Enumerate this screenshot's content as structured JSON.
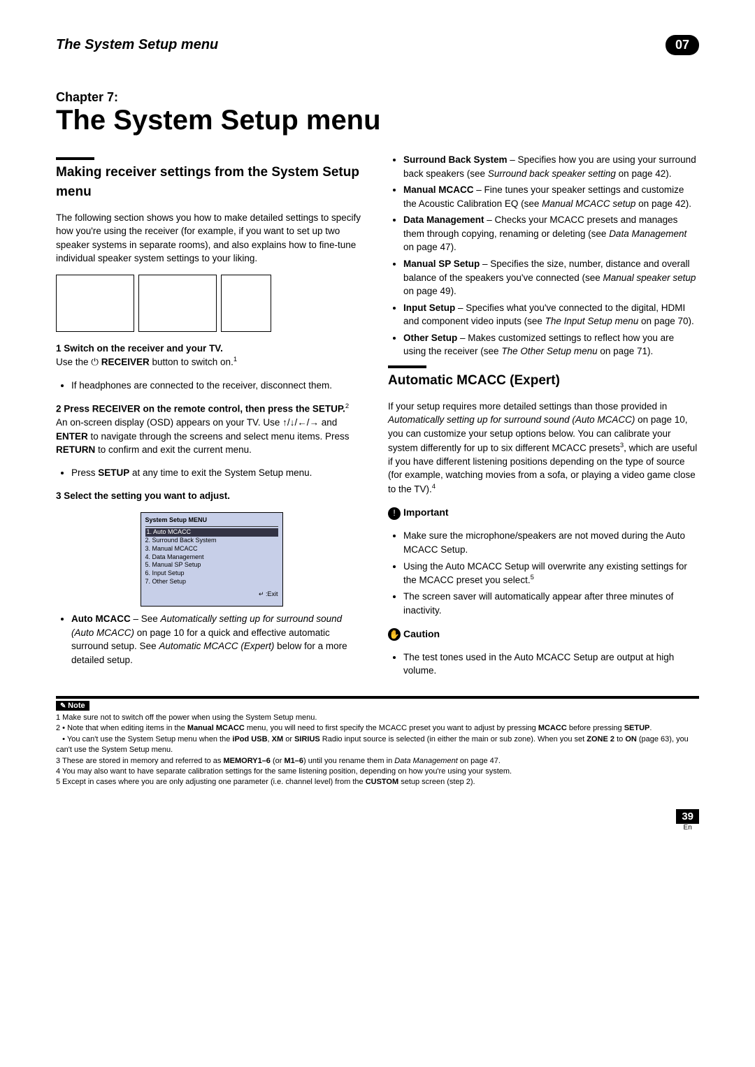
{
  "header": {
    "title": "The System Setup menu",
    "badge": "07"
  },
  "chapter": {
    "label": "Chapter 7:",
    "title": "The System Setup menu"
  },
  "col1": {
    "section_title": "Making receiver settings from the System Setup menu",
    "intro": "The following section shows you how to make detailed settings to specify how you're using the receiver (for example, if you want to set up two speaker systems in separate rooms), and also explains how to fine-tune individual speaker system settings to your liking.",
    "step1_label": "1   Switch on the receiver and your TV.",
    "step1_text_a": "Use the ",
    "step1_receiver": " RECEIVER",
    "step1_text_b": " button to switch on.",
    "step1_sup": "1",
    "step1_bullet": "If headphones are connected to the receiver, disconnect them.",
    "step2_label": "2   Press RECEIVER on the remote control, then press the SETUP.",
    "step2_sup": "2",
    "step2_text": "An on-screen display (OSD) appears on your TV. Use ↑/↓/←/→ and ENTER to navigate through the screens and select menu items. Press RETURN to confirm and exit the current menu.",
    "step2_bullet_a": "Press ",
    "step2_bullet_setup": "SETUP",
    "step2_bullet_b": " at any time to exit the System Setup menu.",
    "step3_label": "3   Select the setting you want to adjust.",
    "osd": {
      "title": "System Setup MENU",
      "items": [
        "1. Auto MCACC",
        "2. Surround Back System",
        "3. Manual MCACC",
        "4. Data Management",
        "5. Manual SP Setup",
        "6. Input Setup",
        "7. Other Setup"
      ],
      "exit": "↵ :Exit"
    },
    "auto_mcacc_a": "Auto MCACC",
    "auto_mcacc_b": " – See ",
    "auto_mcacc_c": "Automatically setting up for surround sound (Auto MCACC)",
    "auto_mcacc_d": " on page 10 for a quick and effective automatic surround setup. See ",
    "auto_mcacc_e": "Automatic MCACC (Expert)",
    "auto_mcacc_f": " below for a more detailed setup."
  },
  "col2": {
    "items": [
      {
        "name": "Surround Back System",
        "desc": " – Specifies how you are using your surround back speakers (see ",
        "ref": "Surround back speaker setting",
        "tail": " on page 42)."
      },
      {
        "name": "Manual MCACC",
        "desc": " – Fine tunes your speaker settings and customize the Acoustic Calibration EQ (see ",
        "ref": "Manual MCACC setup",
        "tail": " on page 42)."
      },
      {
        "name": "Data Management",
        "desc": " – Checks your MCACC presets and manages them through copying, renaming or deleting (see ",
        "ref": "Data Management",
        "tail": " on page 47)."
      },
      {
        "name": "Manual SP Setup",
        "desc": " – Specifies the size, number, distance and overall balance of the speakers you've connected (see ",
        "ref": "Manual speaker setup",
        "tail": " on page 49)."
      },
      {
        "name": "Input Setup",
        "desc": " – Specifies what you've connected to the digital, HDMI and component video inputs (see ",
        "ref": "The Input Setup menu",
        "tail": " on page 70)."
      },
      {
        "name": "Other Setup",
        "desc": " – Makes customized settings to reflect how you are using the receiver (see ",
        "ref": "The Other Setup menu",
        "tail": " on page 71)."
      }
    ],
    "expert_title": "Automatic MCACC (Expert)",
    "expert_body_a": "If your setup requires more detailed settings than those provided in ",
    "expert_body_b": "Automatically setting up for surround sound (Auto MCACC)",
    "expert_body_c": " on page 10, you can customize your setup options below. You can calibrate your system differently for up to six different MCACC presets",
    "expert_sup3": "3",
    "expert_body_d": ", which are useful if you have different listening positions depending on the type of source (for example, watching movies from a sofa, or playing a video game close to the TV).",
    "expert_sup4": "4",
    "important_label": "Important",
    "important_items": [
      "Make sure the microphone/speakers are not moved during the Auto MCACC Setup.",
      "Using the Auto MCACC Setup will overwrite any existing settings for the MCACC preset you select.",
      "The screen saver will automatically appear after three minutes of inactivity."
    ],
    "important_sup5": "5",
    "caution_label": "Caution",
    "caution_item": "The test tones used in the Auto MCACC Setup are output at high volume."
  },
  "notes": {
    "label": "Note",
    "n1": "1 Make sure not to switch off the power when using the System Setup menu.",
    "n2a": "2 • Note that when editing items in the ",
    "n2b": "Manual MCACC",
    "n2c": " menu, you will need to first specify the MCACC preset you want to adjust by pressing ",
    "n2d": "MCACC",
    "n2e": " before pressing ",
    "n2f": "SETUP",
    "n2g": ".",
    "n2h": "• You can't use the System Setup menu when the ",
    "n2i": "iPod USB",
    "n2j": ", ",
    "n2k": "XM",
    "n2l": " or ",
    "n2m": "SIRIUS",
    "n2n": " Radio input source is selected (in either the main or sub zone). When you set ",
    "n2o": "ZONE 2",
    "n2p": " to ",
    "n2q": "ON",
    "n2r": " (page 63), you can't use the System Setup menu.",
    "n3a": "3 These are stored in memory and referred to as ",
    "n3b": "MEMORY1–6",
    "n3c": " (or ",
    "n3d": "M1–6",
    "n3e": ") until you rename them in ",
    "n3f": "Data Management",
    "n3g": " on page 47.",
    "n4": "4 You may also want to have separate calibration settings for the same listening position, depending on how you're using your system.",
    "n5a": "5 Except in cases where you are only adjusting one parameter (i.e. channel level) from the ",
    "n5b": "CUSTOM",
    "n5c": " setup screen (step 2)."
  },
  "footer": {
    "page": "39",
    "lang": "En"
  }
}
